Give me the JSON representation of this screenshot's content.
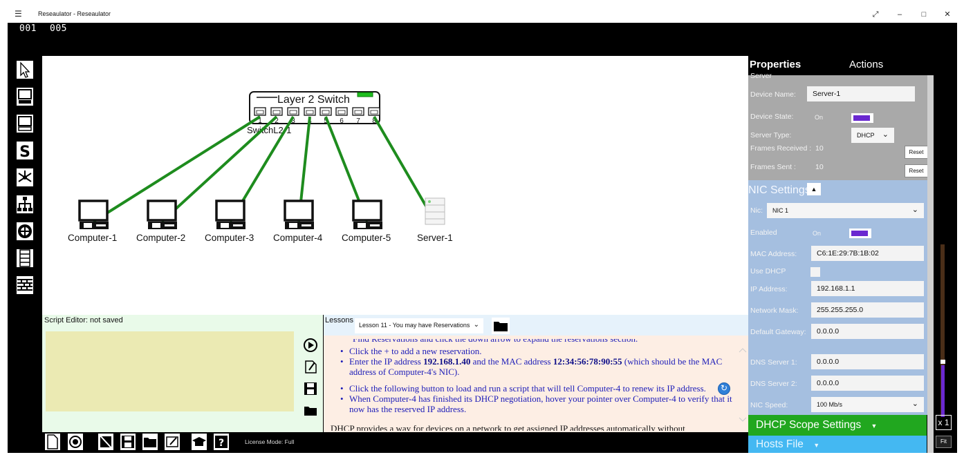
{
  "window": {
    "title": "Reseaulator - Reseaulator",
    "counter_left": "001",
    "counter_right": "005",
    "menu_icon": "hamburger-icon",
    "controls": [
      "expand-icon",
      "minimize-icon",
      "maximize-icon",
      "close-icon"
    ]
  },
  "toolbar": {
    "tools": [
      {
        "name": "select-pointer-icon"
      },
      {
        "name": "add-computer-icon"
      },
      {
        "name": "add-computer-alt-icon"
      },
      {
        "name": "add-switch-icon"
      },
      {
        "name": "add-hub-icon"
      },
      {
        "name": "add-network-icon"
      },
      {
        "name": "add-router-icon"
      },
      {
        "name": "add-server-icon"
      },
      {
        "name": "add-firewall-icon"
      }
    ]
  },
  "canvas": {
    "switch": {
      "title": "Layer 2 Switch",
      "label": "SwitchL2-1",
      "ports": [
        "1",
        "2",
        "3",
        "4",
        "5",
        "6",
        "7",
        "8"
      ]
    },
    "devices": [
      {
        "label": "Computer-1",
        "type": "computer"
      },
      {
        "label": "Computer-2",
        "type": "computer"
      },
      {
        "label": "Computer-3",
        "type": "computer"
      },
      {
        "label": "Computer-4",
        "type": "computer"
      },
      {
        "label": "Computer-5",
        "type": "computer"
      },
      {
        "label": "Server-1",
        "type": "server"
      }
    ],
    "link_color": "#1e8c1e"
  },
  "script_editor": {
    "title": "Script Editor: not saved",
    "buttons": [
      "run-script-icon",
      "edit-script-icon",
      "save-script-icon",
      "open-script-icon"
    ]
  },
  "lessons": {
    "label": "Lessons",
    "selected": "Lesson 11 - You may have Reservations",
    "cut_top": "Find Reservations and click the down arrow to expand the reservations section.",
    "bullets_a": [
      {
        "pre": "Click the + to add a new reservation.",
        "b1": "",
        "mid": "",
        "b2": "",
        "post": ""
      },
      {
        "pre": "Enter the IP address ",
        "b1": "192.168.1.40",
        "mid": " and the MAC address ",
        "b2": "12:34:56:78:90:55",
        "post": " (which should be the MAC address of Computer-4's NIC)."
      }
    ],
    "bullets_b": [
      {
        "text": "Click the following button to load and run a script that will tell Computer-4 to renew its IP address."
      },
      {
        "text": "When Computer-4 has finished its DHCP negotiation, hover your pointer over Computer-4 to verify that it now has the reserved IP address."
      }
    ],
    "cut_bottom": "DHCP provides a way for devices on a network to get assigned IP addresses automatically without"
  },
  "bottom_bar": {
    "buttons": [
      "new-file-icon",
      "record-icon",
      "no-power-icon",
      "save-icon",
      "open-folder-icon",
      "edit-icon",
      "lessons-cap-icon",
      "help-icon"
    ],
    "license": "License Mode: Full"
  },
  "properties": {
    "tab_properties": "Properties",
    "tab_actions": "Actions",
    "section_cut": "Server",
    "device_name_label": "Device Name:",
    "device_name": "Server-1",
    "device_state_label": "Device State:",
    "device_state": "On",
    "server_type_label": "Server Type:",
    "server_type": "DHCP",
    "frames_received_label": "Frames Received :",
    "frames_received": "10",
    "frames_sent_label": "Frames Sent :",
    "frames_sent": "10",
    "reset_label": "Reset",
    "nic_settings": "NIC Settings",
    "nic_label": "Nic:",
    "nic": "NIC 1",
    "enabled_label": "Enabled",
    "enabled": "On",
    "mac_label": "MAC Address:",
    "mac": "C6:1E:29:7B:1B:02",
    "use_dhcp_label": "Use DHCP",
    "ip_label": "IP Address:",
    "ip": "192.168.1.1",
    "mask_label": "Network Mask:",
    "mask": "255.255.255.0",
    "gateway_label": "Default Gateway:",
    "gateway": "0.0.0.0",
    "dns1_label": "DNS Server 1:",
    "dns1": "0.0.0.0",
    "dns2_label": "DNS Server 2:",
    "dns2": "0.0.0.0",
    "speed_label": "NIC Speed:",
    "speed": "100 Mb/s",
    "dhcp_scope": "DHCP Scope Settings",
    "hosts_file": "Hosts File"
  },
  "zoom": {
    "label": "x 1",
    "fit": "Fit",
    "level": 0.3
  },
  "colors": {
    "toggle_on": "#6a28d0",
    "dhcp_bar": "#21a71f",
    "hosts_bar": "#44b8f2",
    "lesson_text": "#1c1cb8"
  }
}
